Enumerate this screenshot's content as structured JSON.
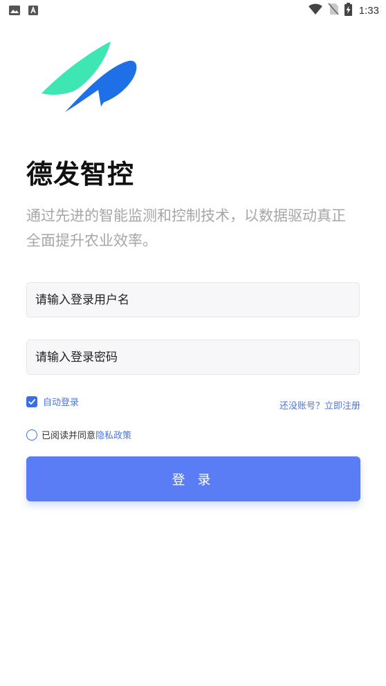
{
  "status_bar": {
    "time": "1:33",
    "icons": [
      "image-icon",
      "text-a-icon",
      "wifi-icon",
      "no-sim-icon",
      "battery-charging-icon"
    ]
  },
  "app": {
    "logo": "brand-logo",
    "title": "德发智控",
    "description": "通过先进的智能监测和控制技术，以数据驱动真正全面提升农业效率。"
  },
  "form": {
    "username_placeholder": "请输入登录用户名",
    "password_placeholder": "请输入登录密码",
    "auto_login_label": "自动登录",
    "auto_login_checked": true,
    "register_link": "还没账号？立即注册",
    "agree_text": "已阅读并同意",
    "privacy_link": "隐私政策",
    "agree_checked": false,
    "login_button": "登 录"
  },
  "colors": {
    "accent": "#5a7cf4",
    "link": "#4d74e0",
    "logo_teal": "#3ee6b4",
    "logo_blue": "#1f6fe6"
  }
}
